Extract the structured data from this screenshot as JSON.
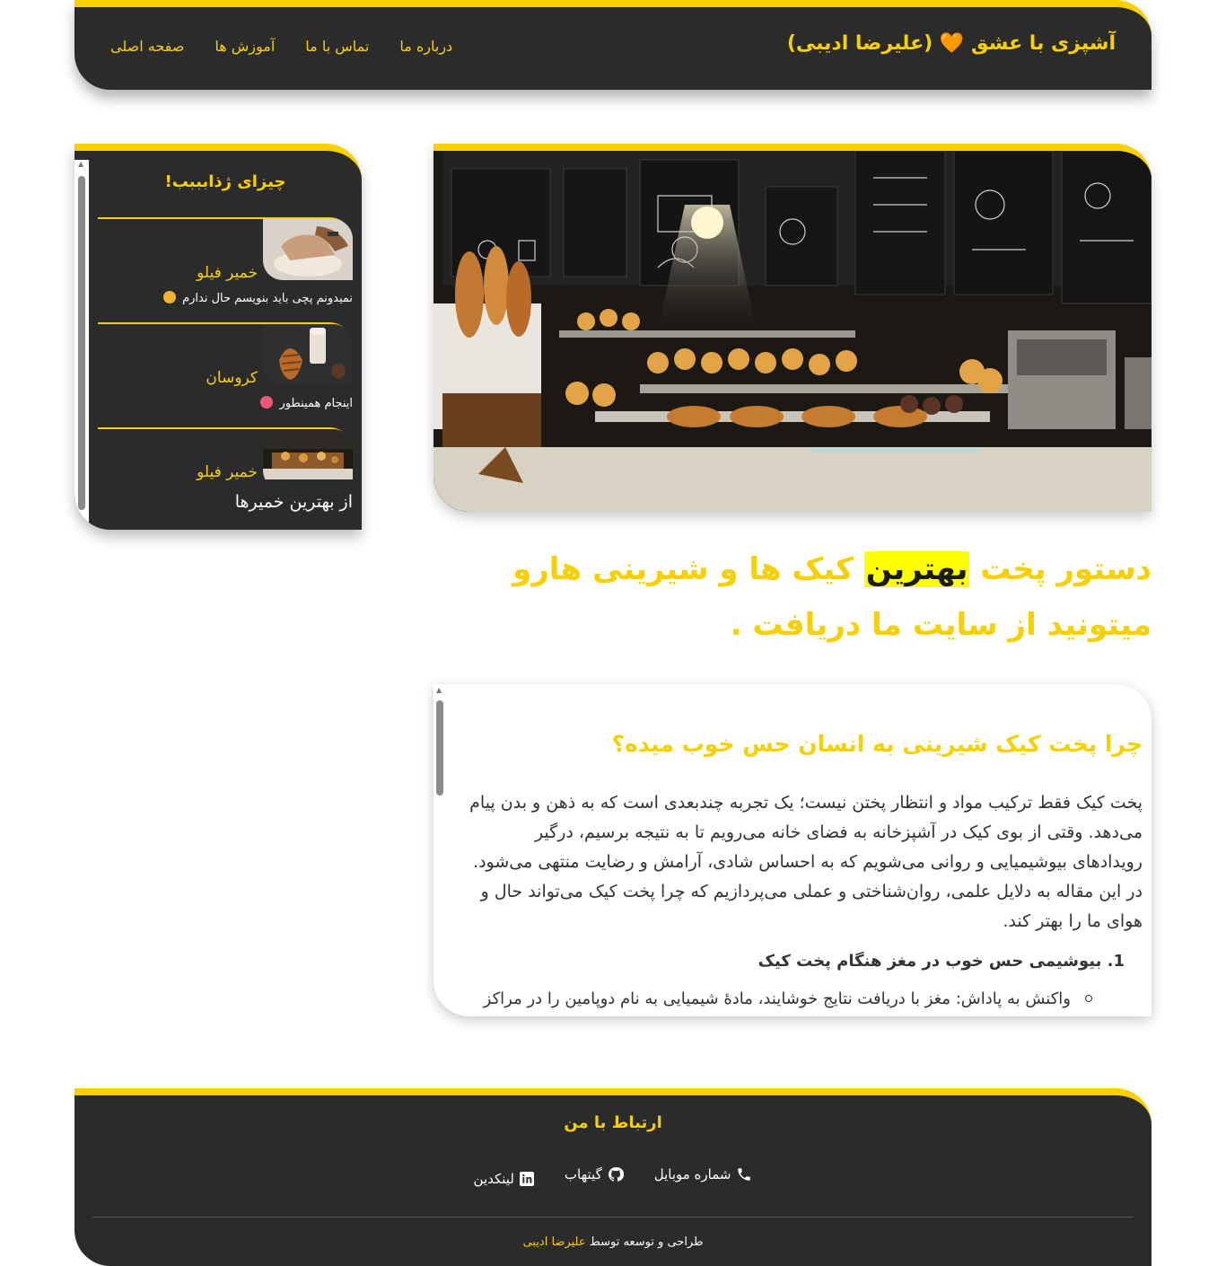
{
  "header": {
    "brand_text": "آشپزی با عشق",
    "brand_author": "(علیرضا ادیبی)",
    "nav": [
      "صفحه اصلی",
      "آموزش ها",
      "تماس با ما",
      "درباره ما"
    ]
  },
  "sidebar": {
    "title": "چیزای ژذابببب!",
    "cards": [
      {
        "name": "خمیر فیلو",
        "desc": "نمیدونم پچی باید بنویسم حال ندارم"
      },
      {
        "name": "کروسان",
        "desc": "اینجام همینطور"
      },
      {
        "name": "خمیر فیلو",
        "desc": "از بهترین خمیرها"
      }
    ]
  },
  "hero": {
    "headline_before": "دستور پخت",
    "headline_mark": "بهترین",
    "headline_after": "کیک ها و شیرینی هارو میتونید از سایت ما دریافت ."
  },
  "article": {
    "title": "چرا پخت کیک شیرینی به انسان حس خوب میده؟",
    "body": "پخت کیک فقط ترکیب مواد و انتظار پختن نیست؛ یک تجربه چندبعدی است که به ذهن و بدن پیام می‌دهد. وقتی از بوی کیک در آشپزخانه به فضای خانه می‌رویم تا به نتیجه برسیم، درگیر رویدادهای بیوشیمیایی و روانی می‌شویم که به احساس شادی، آرامش و رضایت منتهی می‌شود. در این مقاله به دلایل علمی، روان‌شناختی و عملی می‌پردازیم که چرا پخت کیک می‌تواند حال و هوای ما را بهتر کند.",
    "section_number": "1.",
    "section_title": "بیوشیمی حس خوب در مغز هنگام پخت کیک",
    "bullet": "واکنش به پاداش: مغز با دریافت نتایج خوشایند، مادهٔ شیمیایی به نام دوپامین را در مراکز"
  },
  "footer": {
    "title": "ارتباط با من",
    "links": [
      "شماره موبایل",
      "گیتهاب",
      "لینکدین"
    ],
    "credit_prefix": "طراحی و توسعه توسط",
    "credit_name": "علیرضا ادیبی"
  },
  "colors": {
    "accent": "#f8d000",
    "dark": "#2b2b2b",
    "highlight": "#ffff00"
  },
  "icons": [
    "heart-icon",
    "phone-icon",
    "github-icon",
    "linkedin-icon"
  ]
}
